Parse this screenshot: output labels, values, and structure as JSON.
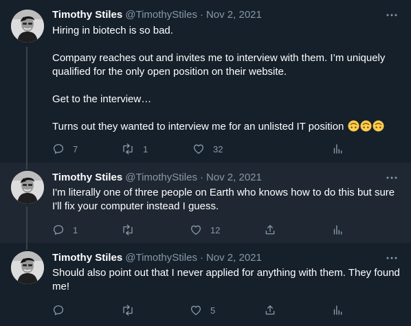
{
  "author": {
    "name": "Timothy Stiles",
    "handle": "@TimothyStiles",
    "separator": "·"
  },
  "icons": {
    "reply": "reply-icon",
    "retweet": "retweet-icon",
    "like": "heart-icon",
    "share": "share-icon",
    "analytics": "analytics-icon",
    "more": "more-icon",
    "emoji": "upside-down-face-emoji"
  },
  "colors": {
    "background": "#15202b",
    "highlighted_background": "#1e2732",
    "text": "#ffffff",
    "muted": "#8899a6",
    "thread_line": "#38444d"
  },
  "tweets": [
    {
      "date": "Nov 2, 2021",
      "paragraphs": [
        "Hiring in biotech is so bad.",
        "Company reaches out and invites me to interview with them. I’m uniquely qualified for the only open position on their website.",
        "Get to the interview…",
        "Turns out they wanted to interview me for an unlisted IT position"
      ],
      "emoji_count": 3,
      "replies": "7",
      "retweets": "1",
      "likes": "32",
      "action_layout": "analytics"
    },
    {
      "date": "Nov 2, 2021",
      "paragraphs": [
        "I'm literally one of three people on Earth who knows how to do this but sure I'll fix your computer instead I guess."
      ],
      "replies": "1",
      "retweets": "",
      "likes": "12",
      "action_layout": "share-analytics"
    },
    {
      "date": "Nov 2, 2021",
      "paragraphs": [
        "Should also point out that I never applied for anything with them. They found me!"
      ],
      "replies": "",
      "retweets": "",
      "likes": "5",
      "action_layout": "share-analytics"
    }
  ]
}
